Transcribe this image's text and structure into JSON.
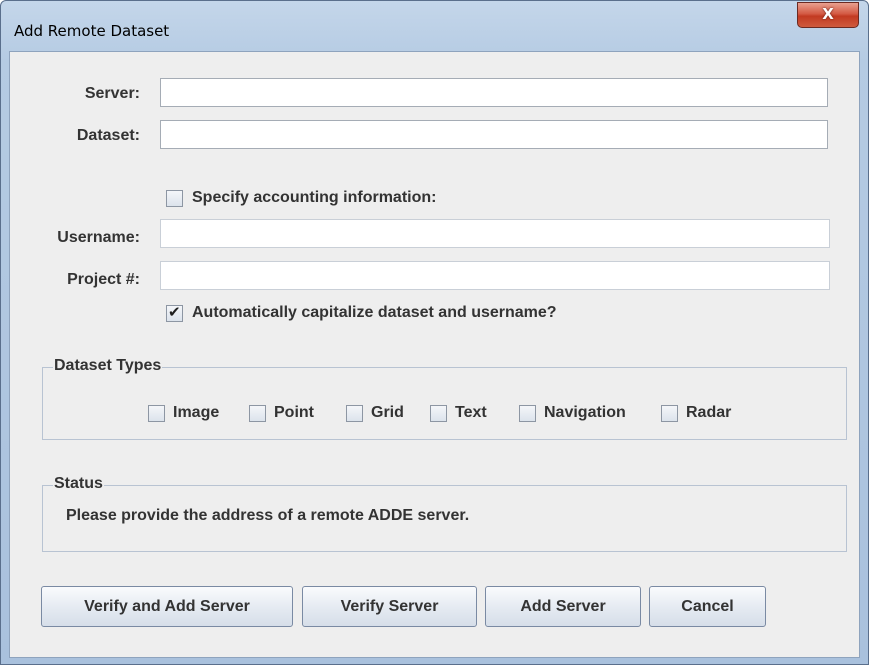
{
  "window": {
    "title": "Add Remote Dataset",
    "close_glyph": "X"
  },
  "form": {
    "server_label": "Server:",
    "server_value": "",
    "dataset_label": "Dataset:",
    "dataset_value": "",
    "accounting_label": "Specify accounting information:",
    "accounting_checked": false,
    "username_label": "Username:",
    "username_value": "",
    "project_label": "Project #:",
    "project_value": "",
    "capitalize_label": "Automatically capitalize dataset and username?",
    "capitalize_checked": true
  },
  "dataset_types": {
    "title": "Dataset Types",
    "items": [
      {
        "label": "Image",
        "checked": false
      },
      {
        "label": "Point",
        "checked": false
      },
      {
        "label": "Grid",
        "checked": false
      },
      {
        "label": "Text",
        "checked": false
      },
      {
        "label": "Navigation",
        "checked": false
      },
      {
        "label": "Radar",
        "checked": false
      }
    ]
  },
  "status": {
    "title": "Status",
    "message": "Please provide the address of a remote ADDE server."
  },
  "buttons": {
    "verify_add": "Verify and Add Server",
    "verify": "Verify Server",
    "add": "Add Server",
    "cancel": "Cancel"
  }
}
